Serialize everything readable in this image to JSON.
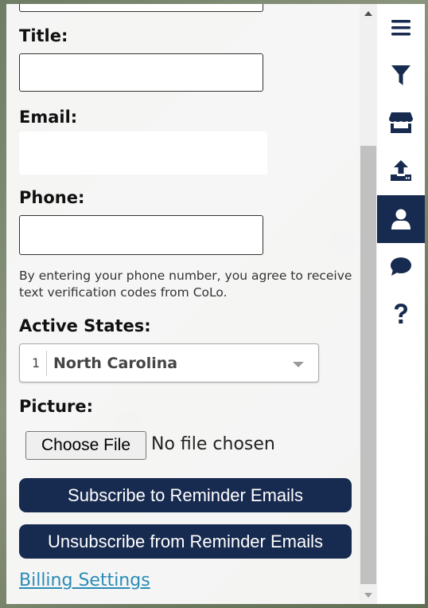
{
  "form": {
    "title_label": "Title:",
    "title_value": "",
    "email_label": "Email:",
    "email_value": "",
    "phone_label": "Phone:",
    "phone_value": "",
    "phone_note": "By entering your phone number, you agree to receive text verification codes from CoLo.",
    "active_states_label": "Active States:",
    "active_states": {
      "count": "1",
      "selected": "North Carolina"
    },
    "picture_label": "Picture:",
    "file_button_label": "Choose File",
    "file_status": "No file chosen",
    "subscribe_label": "Subscribe to Reminder Emails",
    "unsubscribe_label": "Unsubscribe from Reminder Emails",
    "billing_link": "Billing Settings"
  },
  "toolbar": {
    "items": [
      {
        "icon": "menu-icon",
        "active": false
      },
      {
        "icon": "filter-icon",
        "active": false
      },
      {
        "icon": "store-icon",
        "active": false
      },
      {
        "icon": "upload-icon",
        "active": false
      },
      {
        "icon": "user-icon",
        "active": true
      },
      {
        "icon": "chat-icon",
        "active": false
      },
      {
        "icon": "help-icon",
        "active": false
      }
    ]
  },
  "colors": {
    "accent": "#172a4f",
    "link": "#2a8bb8",
    "icon": "#172a4f",
    "active_icon": "#ffffff"
  }
}
